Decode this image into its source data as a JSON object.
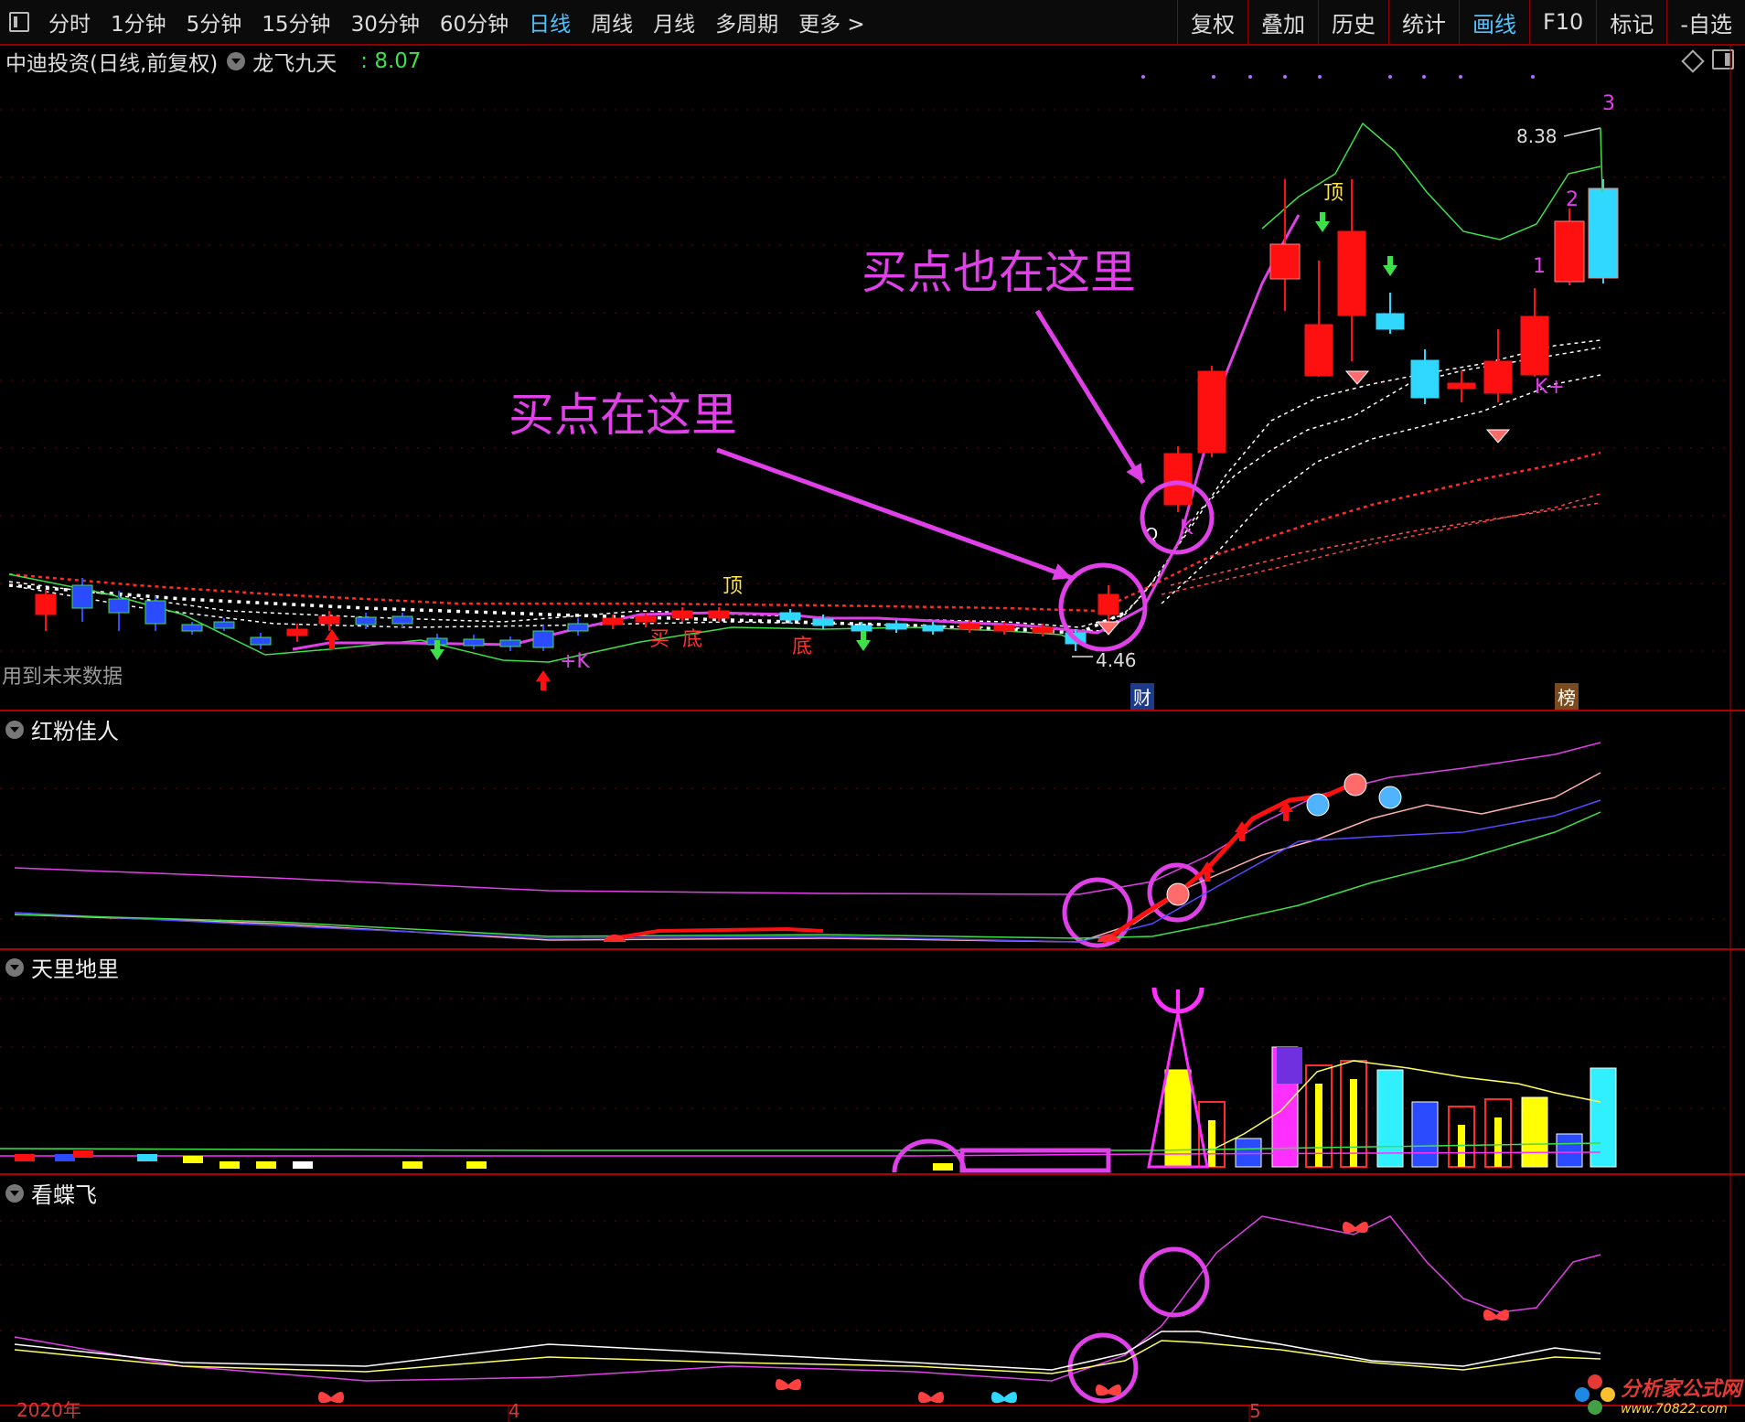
{
  "toolbar": {
    "left_items": [
      "分时",
      "1分钟",
      "5分钟",
      "15分钟",
      "30分钟",
      "60分钟",
      "日线",
      "周线",
      "月线",
      "多周期",
      "更多 >"
    ],
    "active_item": "日线",
    "right_items": [
      "复权",
      "叠加",
      "历史",
      "统计",
      "画线",
      "F10",
      "标记",
      "-自选"
    ],
    "active_right": "画线"
  },
  "main_panel": {
    "stock_name": "中迪投资(日线,前复权)",
    "indicator_name": "龙飞九天",
    "indicator_value": ": 8.07",
    "future_data_note": "用到未来数据",
    "high_price_label": "8.38",
    "low_price_label": "4.46",
    "annotation_buy_1": "买点在这里",
    "annotation_buy_2": "买点也在这里",
    "label_top": "顶",
    "label_buy": "买",
    "label_bottom": "底",
    "label_k": "K",
    "label_k_plus": "+K",
    "label_k_plus_2": "K+",
    "label_qi": "Q",
    "label_num_1": "1",
    "label_num_2": "2",
    "label_num_3": "3",
    "badge_cai": "财",
    "badge_bang": "榜"
  },
  "panels": {
    "p1_title": "红粉佳人",
    "p2_title": "天里地里",
    "p3_title": "看蝶飞"
  },
  "dates": [
    "2020年",
    "4",
    "5"
  ],
  "watermark": {
    "name": "分析家公式网",
    "url": "www.70822.com"
  },
  "colors": {
    "accent_blue": "#4fc3ff",
    "up_red": "#ff1010",
    "down_cyan": "#30d8ff",
    "annotation_magenta": "#e040e8",
    "value_green": "#3ee04a"
  }
}
